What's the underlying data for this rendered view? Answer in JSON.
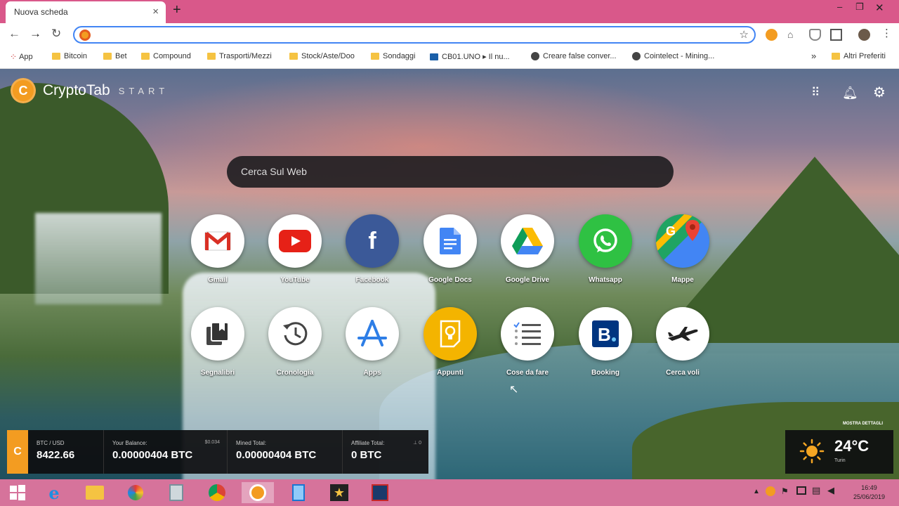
{
  "browser": {
    "tab_title": "Nuova scheda",
    "new_tab_symbol": "+",
    "bookmarks": [
      {
        "label": "App",
        "kind": "apps"
      },
      {
        "label": "Bitcoin",
        "kind": "folder"
      },
      {
        "label": "Bet",
        "kind": "folder"
      },
      {
        "label": "Compound",
        "kind": "folder"
      },
      {
        "label": "Trasporti/Mezzi",
        "kind": "folder"
      },
      {
        "label": "Stock/Aste/Doo",
        "kind": "folder"
      },
      {
        "label": "Sondaggi",
        "kind": "folder"
      },
      {
        "label": "CB01.UNO ▸ Il nu...",
        "kind": "page"
      },
      {
        "label": "Creare false conver...",
        "kind": "globe"
      },
      {
        "label": "Cointelect - Mining...",
        "kind": "globe"
      },
      {
        "label": "»",
        "kind": "more"
      },
      {
        "label": "Altri Preferiti",
        "kind": "folder"
      }
    ]
  },
  "page": {
    "logo_name": "CryptoTab",
    "logo_sub": "START",
    "logo_letter": "C",
    "search_placeholder": "Cerca Sul Web",
    "tiles_row1": [
      {
        "label": "Gmail",
        "icon": "gmail-icon"
      },
      {
        "label": "YouTube",
        "icon": "youtube-icon"
      },
      {
        "label": "Facebook",
        "icon": "facebook-icon"
      },
      {
        "label": "Google Docs",
        "icon": "google-docs-icon"
      },
      {
        "label": "Google Drive",
        "icon": "google-drive-icon"
      },
      {
        "label": "Whatsapp",
        "icon": "whatsapp-icon"
      },
      {
        "label": "Mappe",
        "icon": "maps-icon"
      }
    ],
    "tiles_row2": [
      {
        "label": "Segnalibri",
        "icon": "bookmarks-icon"
      },
      {
        "label": "Cronologia",
        "icon": "history-icon"
      },
      {
        "label": "Apps",
        "icon": "apps-icon"
      },
      {
        "label": "Appunti",
        "icon": "notes-icon"
      },
      {
        "label": "Cose da fare",
        "icon": "todo-icon"
      },
      {
        "label": "Booking",
        "icon": "booking-icon"
      },
      {
        "label": "Cerca voli",
        "icon": "flights-icon"
      }
    ],
    "stats": {
      "btc_usd_label": "BTC / USD",
      "btc_usd_value": "8422.66",
      "balance_label": "Your Balance:",
      "balance_extra": "$0.034",
      "balance_value": "0.00000404 BTC",
      "mined_label": "Mined Total:",
      "mined_value": "0.00000404 BTC",
      "affiliate_label": "Affiliate Total:",
      "affiliate_extra": "⊥ 0",
      "affiliate_value": "0 BTC"
    },
    "show_details": "MOSTRA DETTAGLI",
    "weather": {
      "temp": "24°C",
      "city": "Turin"
    }
  },
  "taskbar": {
    "time": "16:49",
    "date": "25/06/2019"
  }
}
